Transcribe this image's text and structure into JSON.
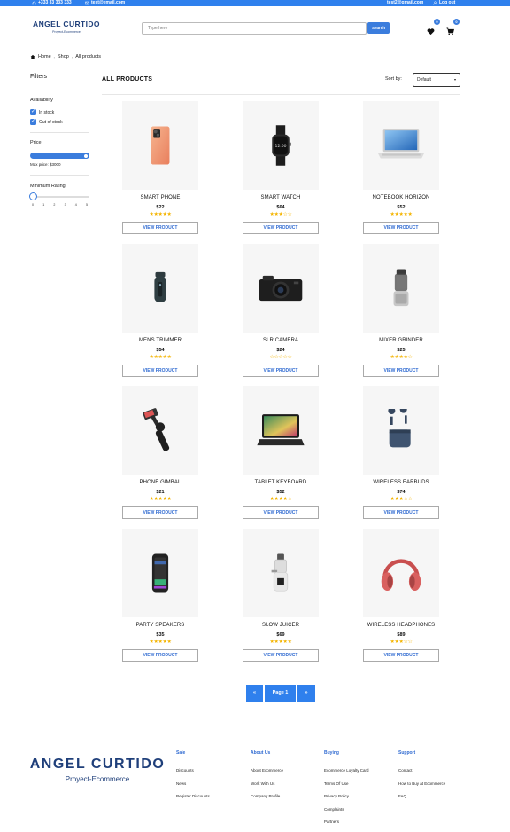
{
  "topbar": {
    "phone": "+333 33 333 333",
    "email": "test@email.com",
    "user_email": "test2@gmail.com",
    "logout": "Log out",
    "color": "#2f80ed"
  },
  "header": {
    "logo_name": "ANGEL CURTIDO",
    "logo_sub": "Proyect-Ecommerce",
    "search_placeholder": "Type here",
    "search_button": "Search",
    "wishlist_count": "0",
    "cart_count": "0"
  },
  "breadcrumb": {
    "home": "Home",
    "shop": "Shop",
    "current": "All products"
  },
  "filters": {
    "title": "Filters",
    "availability_label": "Availability",
    "in_stock": "In stock",
    "out_of_stock": "Out of stock",
    "price_label": "Price",
    "price_fraction": 1.0,
    "max_price": "Max price: $3000",
    "rating_label": "Minimum Rating:",
    "rating_ticks": [
      "0",
      "1",
      "2",
      "3",
      "4",
      "5"
    ],
    "rating_value": 0
  },
  "main": {
    "title": "ALL PRODUCTS",
    "sort_label": "Sort by:",
    "sort_value": "Default",
    "view_label": "VIEW PRODUCT"
  },
  "products": [
    {
      "name": "SMART PHONE",
      "price": "$22",
      "rating": 5,
      "icon": "phone"
    },
    {
      "name": "SMART WATCH",
      "price": "$64",
      "rating": 3,
      "icon": "watch"
    },
    {
      "name": "NOTEBOOK HORIZON",
      "price": "$52",
      "rating": 5,
      "icon": "laptop"
    },
    {
      "name": "MENS TRIMMER",
      "price": "$54",
      "rating": 5,
      "icon": "trimmer"
    },
    {
      "name": "SLR CAMERA",
      "price": "$24",
      "rating": 0,
      "icon": "camera"
    },
    {
      "name": "MIXER GRINDER",
      "price": "$25",
      "rating": 4,
      "icon": "mixer"
    },
    {
      "name": "PHONE GIMBAL",
      "price": "$21",
      "rating": 5,
      "icon": "gimbal"
    },
    {
      "name": "TABLET KEYBOARD",
      "price": "$52",
      "rating": 4,
      "icon": "tablet"
    },
    {
      "name": "WIRELESS EARBUDS",
      "price": "$74",
      "rating": 3,
      "icon": "earbuds"
    },
    {
      "name": "PARTY SPEAKERS",
      "price": "$35",
      "rating": 5,
      "icon": "speaker"
    },
    {
      "name": "SLOW JUICER",
      "price": "$69",
      "rating": 5,
      "icon": "juicer"
    },
    {
      "name": "WIRELESS HEADPHONES",
      "price": "$89",
      "rating": 3,
      "icon": "headphones"
    }
  ],
  "pagination": {
    "prev": "«",
    "current": "Page 1",
    "next": "»"
  },
  "footer": {
    "logo_name": "ANGEL CURTIDO",
    "logo_sub": "Proyect-Ecommerce",
    "columns": [
      {
        "title": "Sale",
        "links": [
          "Discounts",
          "News",
          "Register Discounts"
        ]
      },
      {
        "title": "About Us",
        "links": [
          "About Ecommerce",
          "Work With Us",
          "Company Profile"
        ]
      },
      {
        "title": "Buying",
        "links": [
          "Ecommerce Loyalty Card",
          "Terms Of Use",
          "Privacy Policy",
          "Complaints",
          "Partners"
        ]
      },
      {
        "title": "Support",
        "links": [
          "Contact",
          "How to Buy at Ecommerce",
          "FAQ"
        ]
      }
    ]
  },
  "colors": {
    "accent": "#2f80ed",
    "brand": "#1f3f7a",
    "star": "#f4b400",
    "link": "#2f6ad1"
  }
}
